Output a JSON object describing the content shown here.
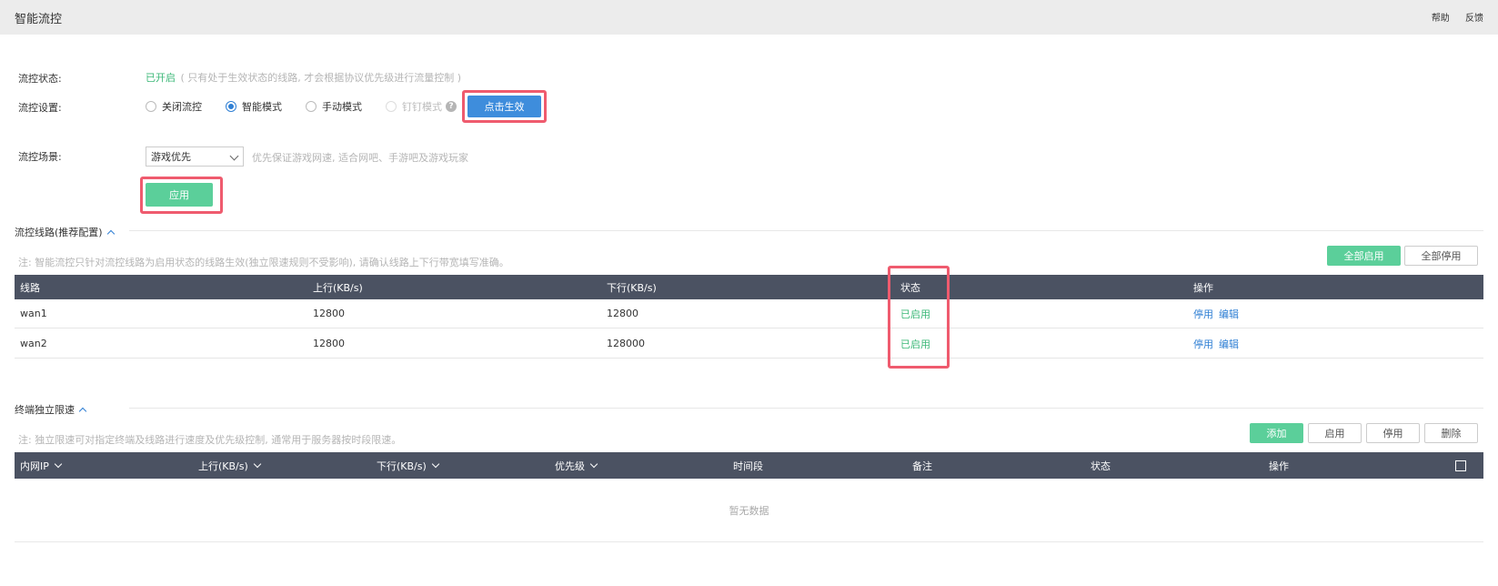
{
  "header": {
    "title": "智能流控",
    "help": "帮助",
    "feedback": "反馈"
  },
  "flow_status": {
    "label": "流控状态:",
    "value": "已开启",
    "note": "( 只有处于生效状态的线路, 才会根据协议优先级进行流量控制 )"
  },
  "flow_settings": {
    "label": "流控设置:",
    "options": [
      {
        "label": "关闭流控",
        "checked": false,
        "disabled": false
      },
      {
        "label": "智能模式",
        "checked": true,
        "disabled": false
      },
      {
        "label": "手动模式",
        "checked": false,
        "disabled": false
      },
      {
        "label": "钉钉模式",
        "checked": false,
        "disabled": true
      }
    ],
    "apply_button": "点击生效"
  },
  "scene": {
    "label": "流控场景:",
    "selected": "游戏优先",
    "hint": "优先保证游戏网速, 适合网吧、手游吧及游戏玩家",
    "apply_button": "应用"
  },
  "lines_section": {
    "title": "流控线路(推荐配置)",
    "note": "注: 智能流控只针对流控线路为启用状态的线路生效(独立限速规则不受影响), 请确认线路上下行带宽填写准确。",
    "enable_all": "全部启用",
    "disable_all": "全部停用",
    "columns": [
      "线路",
      "上行(KB/s)",
      "下行(KB/s)",
      "状态",
      "操作"
    ],
    "rows": [
      {
        "line": "wan1",
        "up": "12800",
        "down": "12800",
        "status": "已启用",
        "op_disable": "停用",
        "op_edit": "编辑"
      },
      {
        "line": "wan2",
        "up": "12800",
        "down": "128000",
        "status": "已启用",
        "op_disable": "停用",
        "op_edit": "编辑"
      }
    ]
  },
  "terminal_section": {
    "title": "终端独立限速",
    "note": "注: 独立限速可对指定终端及线路进行速度及优先级控制, 通常用于服务器按时段限速。",
    "buttons": {
      "add": "添加",
      "enable": "启用",
      "disable": "停用",
      "delete": "删除"
    },
    "columns": [
      "内网IP",
      "上行(KB/s)",
      "下行(KB/s)",
      "优先级",
      "时间段",
      "备注",
      "状态",
      "操作"
    ],
    "empty_text": "暂无数据"
  },
  "colors": {
    "accent_blue": "#3e8ddc",
    "accent_green": "#5bcf9a",
    "highlight": "#ef5b6e",
    "table_header": "#4b5262"
  }
}
